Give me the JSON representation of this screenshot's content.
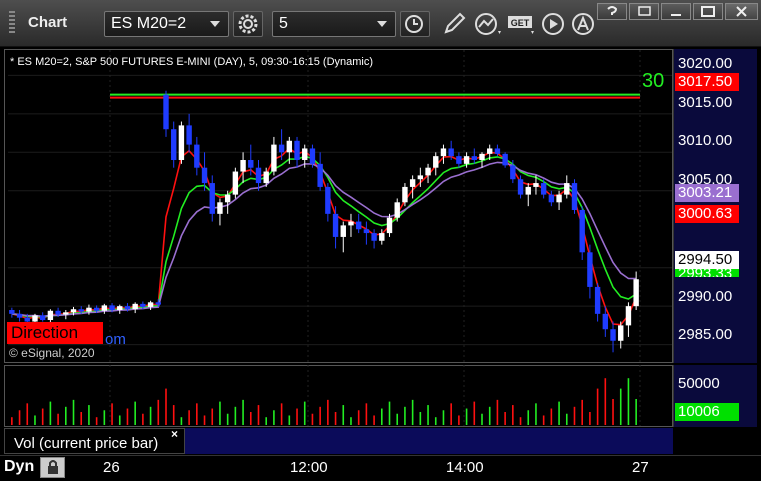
{
  "window": {
    "title": "Chart",
    "symbol_value": "ES M20=2",
    "interval_value": "5",
    "get_label": "GET"
  },
  "chart": {
    "header": "* ES M20=2, S&P 500 FUTURES E-MINI (DAY), 5, 09:30-16:15 (Dynamic)",
    "watermark": "© eSignal, 2020",
    "direction_label": "Direction",
    "direction_suffix": "om",
    "edge_label": "30"
  },
  "price_axis": {
    "ticks": [
      "3020.00",
      "3015.00",
      "3010.00",
      "3005.00",
      "2990.00",
      "2985.00"
    ],
    "badges": [
      {
        "label": "3017.50",
        "bg": "#ff0000",
        "fg": "#ffffff"
      },
      {
        "label": "3003.21",
        "bg": "#9a6fd0",
        "fg": "#ffffff"
      },
      {
        "label": "3000.63",
        "bg": "#ff0000",
        "fg": "#ffffff"
      },
      {
        "label": "2994.50",
        "bg": "#ffffff",
        "fg": "#000000"
      },
      {
        "label": "2993.33",
        "bg": "#00e000",
        "fg": "#ffffff"
      }
    ]
  },
  "volume": {
    "label": "Vol (current price bar)",
    "close_symbol": "×",
    "ticks": [
      "50000"
    ],
    "badge": "10006"
  },
  "time_axis": {
    "mode": "Dyn",
    "ticks": [
      "26",
      "12:00",
      "14:00",
      "27"
    ]
  },
  "colors": {
    "up_candle": "#ffffff",
    "down_candle": "#1f3cff",
    "ma_red": "#ff1010",
    "ma_green": "#22ee22",
    "ma_purple": "#9a6fd0",
    "axis_bg": "#0a0a3c"
  },
  "chart_data": {
    "type": "candlestick",
    "y_range": [
      2983,
      3022
    ],
    "bars": [
      [
        2989.5,
        2989.8,
        2988.5,
        2989
      ],
      [
        2989,
        2989.5,
        2988,
        2988.5
      ],
      [
        2988.5,
        2989,
        2987.5,
        2988
      ],
      [
        2988,
        2989,
        2987.5,
        2988.8
      ],
      [
        2988.8,
        2989.2,
        2988,
        2988.2
      ],
      [
        2988.2,
        2989.6,
        2987.8,
        2989.4
      ],
      [
        2989.4,
        2989.8,
        2988.6,
        2988.9
      ],
      [
        2988.9,
        2989.5,
        2988.3,
        2989.2
      ],
      [
        2989.2,
        2989.9,
        2988.8,
        2989.6
      ],
      [
        2989.6,
        2990,
        2989,
        2989.3
      ],
      [
        2989.3,
        2990.2,
        2988.9,
        2989.8
      ],
      [
        2989.8,
        2990.1,
        2989.1,
        2989.4
      ],
      [
        2989.4,
        2990.3,
        2989,
        2990.1
      ],
      [
        2990.1,
        2990.4,
        2989.2,
        2989.5
      ],
      [
        2989.5,
        2990.2,
        2989,
        2990
      ],
      [
        2990,
        2990.4,
        2989.3,
        2989.6
      ],
      [
        2989.6,
        2990.5,
        2989.1,
        2990.3
      ],
      [
        2990.3,
        2990.6,
        2989.6,
        2989.9
      ],
      [
        2989.9,
        2990.7,
        2989.5,
        2990.5
      ],
      [
        2990.5,
        2990.9,
        2989.9,
        2990.2
      ],
      [
        3017.5,
        3018,
        3012,
        3013
      ],
      [
        3013,
        3014,
        3008,
        3009
      ],
      [
        3009,
        3014,
        3008.5,
        3013.5
      ],
      [
        3013.5,
        3015,
        3010,
        3011
      ],
      [
        3011,
        3012,
        3007,
        3008
      ],
      [
        3008,
        3010,
        3005,
        3006
      ],
      [
        3006,
        3007,
        3001,
        3002
      ],
      [
        3002,
        3004,
        3000.5,
        3003.5
      ],
      [
        3003.5,
        3005,
        3002,
        3004.5
      ],
      [
        3004.5,
        3008,
        3004,
        3007.5
      ],
      [
        3007.5,
        3010,
        3006,
        3009
      ],
      [
        3009,
        3011,
        3007,
        3008
      ],
      [
        3008,
        3009,
        3005,
        3006
      ],
      [
        3006,
        3008,
        3005.5,
        3007.5
      ],
      [
        3007.5,
        3012,
        3007,
        3011
      ],
      [
        3011,
        3013,
        3009,
        3010
      ],
      [
        3010,
        3012,
        3008.5,
        3011.5
      ],
      [
        3011.5,
        3012,
        3008,
        3009
      ],
      [
        3009,
        3011,
        3008,
        3010.5
      ],
      [
        3010.5,
        3011,
        3008,
        3008.5
      ],
      [
        3008.5,
        3010,
        3005,
        3005.5
      ],
      [
        3005.5,
        3006,
        3001,
        3002
      ],
      [
        3002,
        3003,
        2997.5,
        2999
      ],
      [
        2999,
        3001,
        2997,
        3000.5
      ],
      [
        3000.5,
        3002,
        2999,
        3001
      ],
      [
        3001,
        3002,
        2999.5,
        3000
      ],
      [
        3000,
        3001,
        2998,
        2999.5
      ],
      [
        2999.5,
        3000,
        2997.5,
        2998.5
      ],
      [
        2998.5,
        3000,
        2998,
        2999.5
      ],
      [
        2999.5,
        3002,
        2999,
        3001.5
      ],
      [
        3001.5,
        3004,
        3001,
        3003.5
      ],
      [
        3003.5,
        3006,
        3003,
        3005.5
      ],
      [
        3005.5,
        3007,
        3004,
        3006.5
      ],
      [
        3006.5,
        3008,
        3005.5,
        3007
      ],
      [
        3007,
        3008.5,
        3006,
        3008
      ],
      [
        3008,
        3010,
        3007,
        3009.5
      ],
      [
        3009.5,
        3011,
        3008.5,
        3010.5
      ],
      [
        3010.5,
        3011.5,
        3009,
        3009.5
      ],
      [
        3009.5,
        3010,
        3008,
        3008.5
      ],
      [
        3008.5,
        3010,
        3008,
        3009.5
      ],
      [
        3009.5,
        3010.5,
        3008.5,
        3009
      ],
      [
        3009,
        3010,
        3008,
        3009.8
      ],
      [
        3009.8,
        3011,
        3009,
        3010.5
      ],
      [
        3010.5,
        3011,
        3009.5,
        3009.8
      ],
      [
        3009.8,
        3010,
        3008,
        3008.3
      ],
      [
        3008.3,
        3009,
        3006,
        3006.5
      ],
      [
        3006.5,
        3007,
        3004,
        3004.5
      ],
      [
        3004.5,
        3006,
        3003,
        3005.5
      ],
      [
        3005.5,
        3007,
        3004.5,
        3006
      ],
      [
        3006,
        3006.5,
        3004,
        3004.5
      ],
      [
        3004.5,
        3005,
        3003,
        3003.5
      ],
      [
        3003.5,
        3005,
        3002.5,
        3004.5
      ],
      [
        3004.5,
        3007,
        3004,
        3006
      ],
      [
        3006,
        3006.5,
        3002,
        3002.5
      ],
      [
        3002.5,
        3003,
        2996,
        2997
      ],
      [
        2997,
        2998,
        2991,
        2992.5
      ],
      [
        2992.5,
        2993,
        2988,
        2989
      ],
      [
        2989,
        2990,
        2986,
        2987
      ],
      [
        2987,
        2988,
        2984,
        2985.5
      ],
      [
        2985.5,
        2988,
        2984.5,
        2987.5
      ],
      [
        2987.5,
        2990.5,
        2986,
        2990
      ],
      [
        2990,
        2994.5,
        2989.5,
        2993.5
      ]
    ],
    "volume_max": 60000
  }
}
